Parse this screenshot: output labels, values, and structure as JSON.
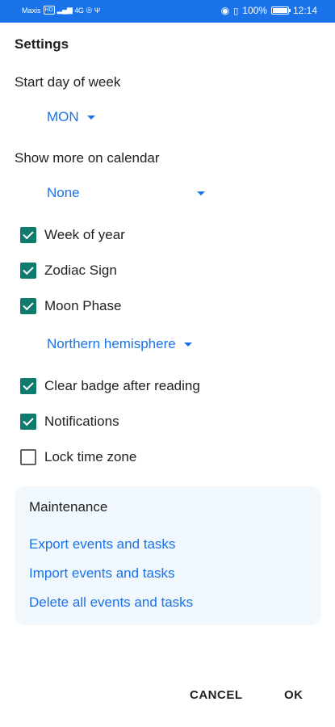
{
  "status_bar": {
    "carrier": "Maxis",
    "hd_badge": "HD",
    "network": "4G",
    "battery": "100%",
    "time": "12:14"
  },
  "dialog": {
    "title": "Settings",
    "start_day": {
      "label": "Start day of week",
      "value": "MON"
    },
    "show_more": {
      "label": "Show more on calendar",
      "value": "None"
    },
    "options": [
      {
        "label": "Week of year",
        "checked": true
      },
      {
        "label": "Zodiac Sign",
        "checked": true
      },
      {
        "label": "Moon Phase",
        "checked": true
      }
    ],
    "hemisphere": {
      "value": "Northern hemisphere"
    },
    "options2": [
      {
        "label": "Clear badge after reading",
        "checked": true
      },
      {
        "label": "Notifications",
        "checked": true
      },
      {
        "label": "Lock time zone",
        "checked": false
      }
    ],
    "maintenance": {
      "title": "Maintenance",
      "links": [
        "Export events and tasks",
        "Import events and tasks",
        "Delete all events and tasks"
      ]
    },
    "buttons": {
      "cancel": "CANCEL",
      "ok": "OK"
    }
  },
  "colors": {
    "status_bar": "#1a73e8",
    "accent": "#1a73e8",
    "checkbox": "#0f7b6c",
    "card_bg": "#f0f7fd"
  }
}
